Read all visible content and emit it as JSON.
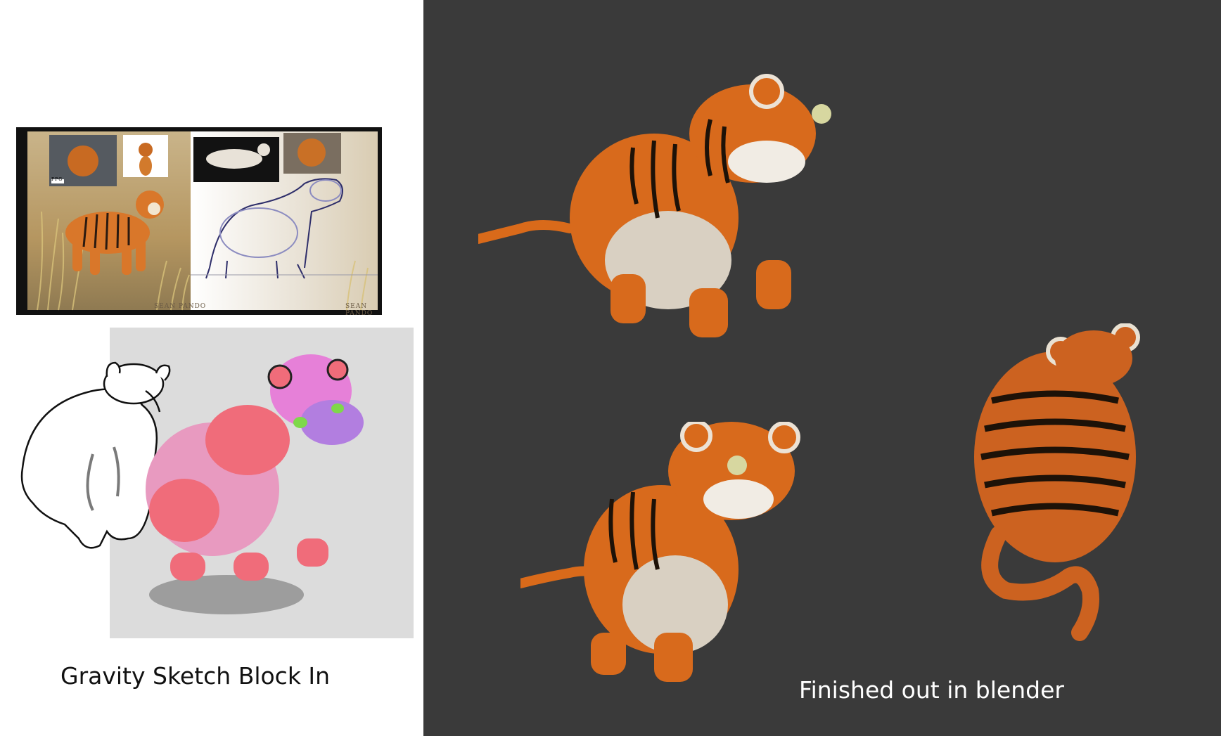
{
  "captions": {
    "left": "Gravity Sketch Block In",
    "right": "Finished out in blender"
  },
  "reference_sheet": {
    "signatures": [
      "SEAN PANDO",
      "SEAN PANDO"
    ],
    "thumbnail_tag": "FPG"
  },
  "colors": {
    "right_background": "#3a3a3a",
    "left_background": "#ffffff",
    "tiger_orange": "#d86a1c",
    "block_in_pink": "#f06c7a",
    "block_in_backdrop": "#dcdcdc"
  }
}
